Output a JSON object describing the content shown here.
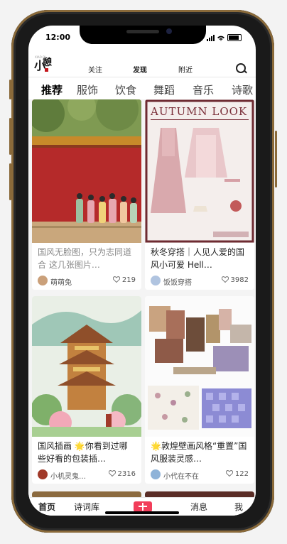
{
  "status": {
    "time": "12:00"
  },
  "top_nav": {
    "tabs": [
      "关注",
      "发现",
      "附近"
    ],
    "active": "发现",
    "logo_text": "小憩"
  },
  "categories": [
    "推荐",
    "服饰",
    "饮食",
    "舞蹈",
    "音乐",
    "诗歌"
  ],
  "feed": [
    {
      "title": "国风无脸图，只为志同道合 这几张图片…",
      "author": "萌萌兔",
      "likes": "219",
      "title_color": "gray"
    },
    {
      "title": "秋冬穿搭｜人见人爱的国风小可爱 Hell…",
      "author": "饭饭穿搭",
      "likes": "3982",
      "title_color": "dark",
      "poster_heading": "AUTUMN LOOK"
    },
    {
      "title": "国风插画 🌟你看到过哪些好看的包装插…",
      "author": "小机灵鬼…",
      "likes": "2316",
      "title_color": "dark"
    },
    {
      "title": "🌟敦煌壁画风格“重置”国风服装灵感…",
      "author": "小代在不在",
      "likes": "122",
      "title_color": "dark"
    }
  ],
  "bottom_tabs": {
    "home": "首页",
    "poetry": "诗词库",
    "messages": "消息",
    "me": "我"
  },
  "colors": {
    "accent": "#f23d5a",
    "frame": "#8a6a3a"
  }
}
